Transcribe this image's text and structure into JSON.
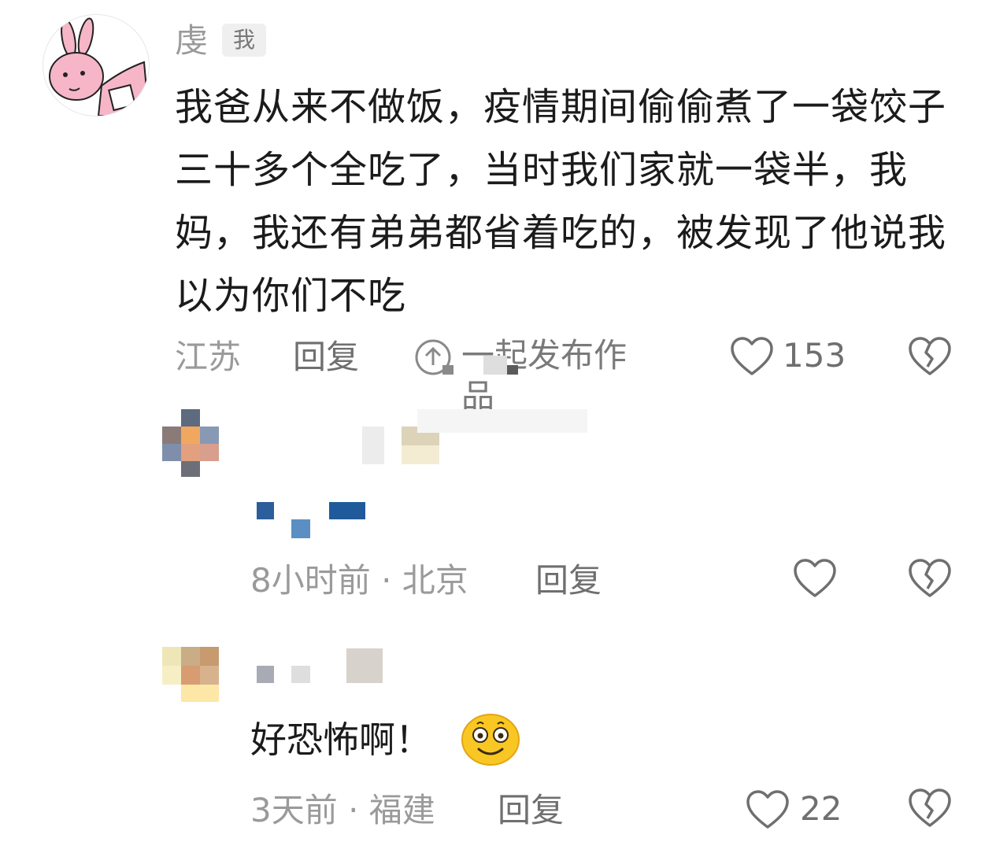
{
  "main_comment": {
    "author": "虔",
    "me_badge": "我",
    "text": "我爸从来不做饭，疫情期间偷偷煮了一袋饺子三十多个全吃了，当时我们家就一袋半，我妈，我还有弟弟都省着吃的，被发现了他说我以为你们不吃",
    "location": "江苏",
    "reply_label": "回复",
    "share_label": "一起发布作品",
    "like_count": "153",
    "icons": [
      "share-icon",
      "heart-icon",
      "broken-heart-icon"
    ]
  },
  "replies": [
    {
      "time_location": "8小时前 · 北京",
      "reply_label": "回复",
      "like_count": "",
      "icons": [
        "heart-icon",
        "broken-heart-icon"
      ]
    },
    {
      "text": "好恐怖啊！",
      "emoji": "smiling-face-emoji",
      "time_location": "3天前 · 福建",
      "reply_label": "回复",
      "like_count": "22",
      "icons": [
        "heart-icon",
        "broken-heart-icon"
      ]
    }
  ]
}
